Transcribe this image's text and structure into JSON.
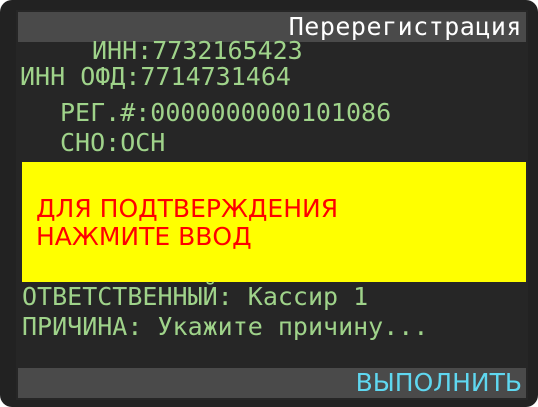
{
  "header": {
    "title": "Перерегистрация"
  },
  "fields": {
    "inn": "ИНН:7732165423",
    "inn_ofd": "ИНН ОФД:7714731464",
    "reg_number": "РЕГ.#:0000000000101086",
    "sno": "СНО:ОСН"
  },
  "notice": {
    "line1": "ДЛЯ ПОДТВЕРЖДЕНИЯ",
    "line2": "НАЖМИТЕ ВВОД",
    "background": "#ffff00",
    "text_color": "#ff0000"
  },
  "details": {
    "responsible": "ОТВЕТСТВЕННЫЙ: Кассир 1",
    "reason": "ПРИЧИНА: Укажите причину..."
  },
  "footer": {
    "execute_label": "ВЫПОЛНИТЬ"
  },
  "colors": {
    "screen_bg": "#262626",
    "bar_bg": "#4a4a4a",
    "field_text": "#9fd38a",
    "action_text": "#5fd7f0",
    "title_text": "#ffffff"
  }
}
